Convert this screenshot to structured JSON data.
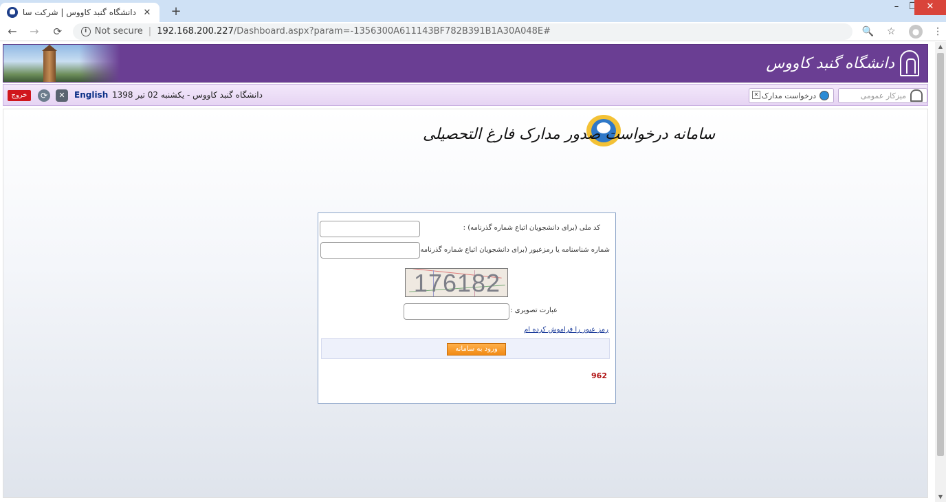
{
  "browser": {
    "tab_title": "دانشگاه گنبد کاووس | شرکت سامان",
    "tab_close": "✕",
    "new_tab": "+",
    "url_secure_label": "Not secure",
    "url_host": "192.168.200.227",
    "url_path": "/Dashboard.aspx?param=-1356300A611143BF782B391B1A30A048E#",
    "window_controls": {
      "minimize": "–",
      "maximize": "❐",
      "close": "✕"
    },
    "nav": {
      "back": "←",
      "forward": "→",
      "reload": "⟳"
    },
    "icons": {
      "zoom": "🔍",
      "star": "☆",
      "menu": "⋮",
      "info": "i"
    }
  },
  "header": {
    "university_name": "دانشگاه گنبد کاووس",
    "colors": {
      "banner": "#6a3e93"
    }
  },
  "infobar": {
    "exit_label": "خروج",
    "language_label": "English",
    "date_text": "دانشگاه گنبد کاووس - یکشنبه 02 تیر 1398",
    "menu_tabs": [
      {
        "label": "درخواست مدارک"
      },
      {
        "label": "میزکار عمومی"
      }
    ],
    "close_x": "✕",
    "refresh_glyph": "⟳"
  },
  "system": {
    "title": "سامانه درخواست صدور مدارک فارغ التحصیلی"
  },
  "login": {
    "national_code_label": "کد ملی (برای دانشجویان اتباع شماره گذرنامه) :",
    "id_number_label": "شماره شناسنامه یا رمزعبور (برای دانشجویان اتباع شماره گذرنامه) :",
    "captcha_text": "176182",
    "captcha_label": "عبارت تصویری :",
    "forgot_link": "رمز عبور را فراموش کرده ام",
    "login_button": "ورود به سامانه",
    "visit_count": "962",
    "national_code_value": "",
    "id_number_value": "",
    "captcha_value": ""
  }
}
